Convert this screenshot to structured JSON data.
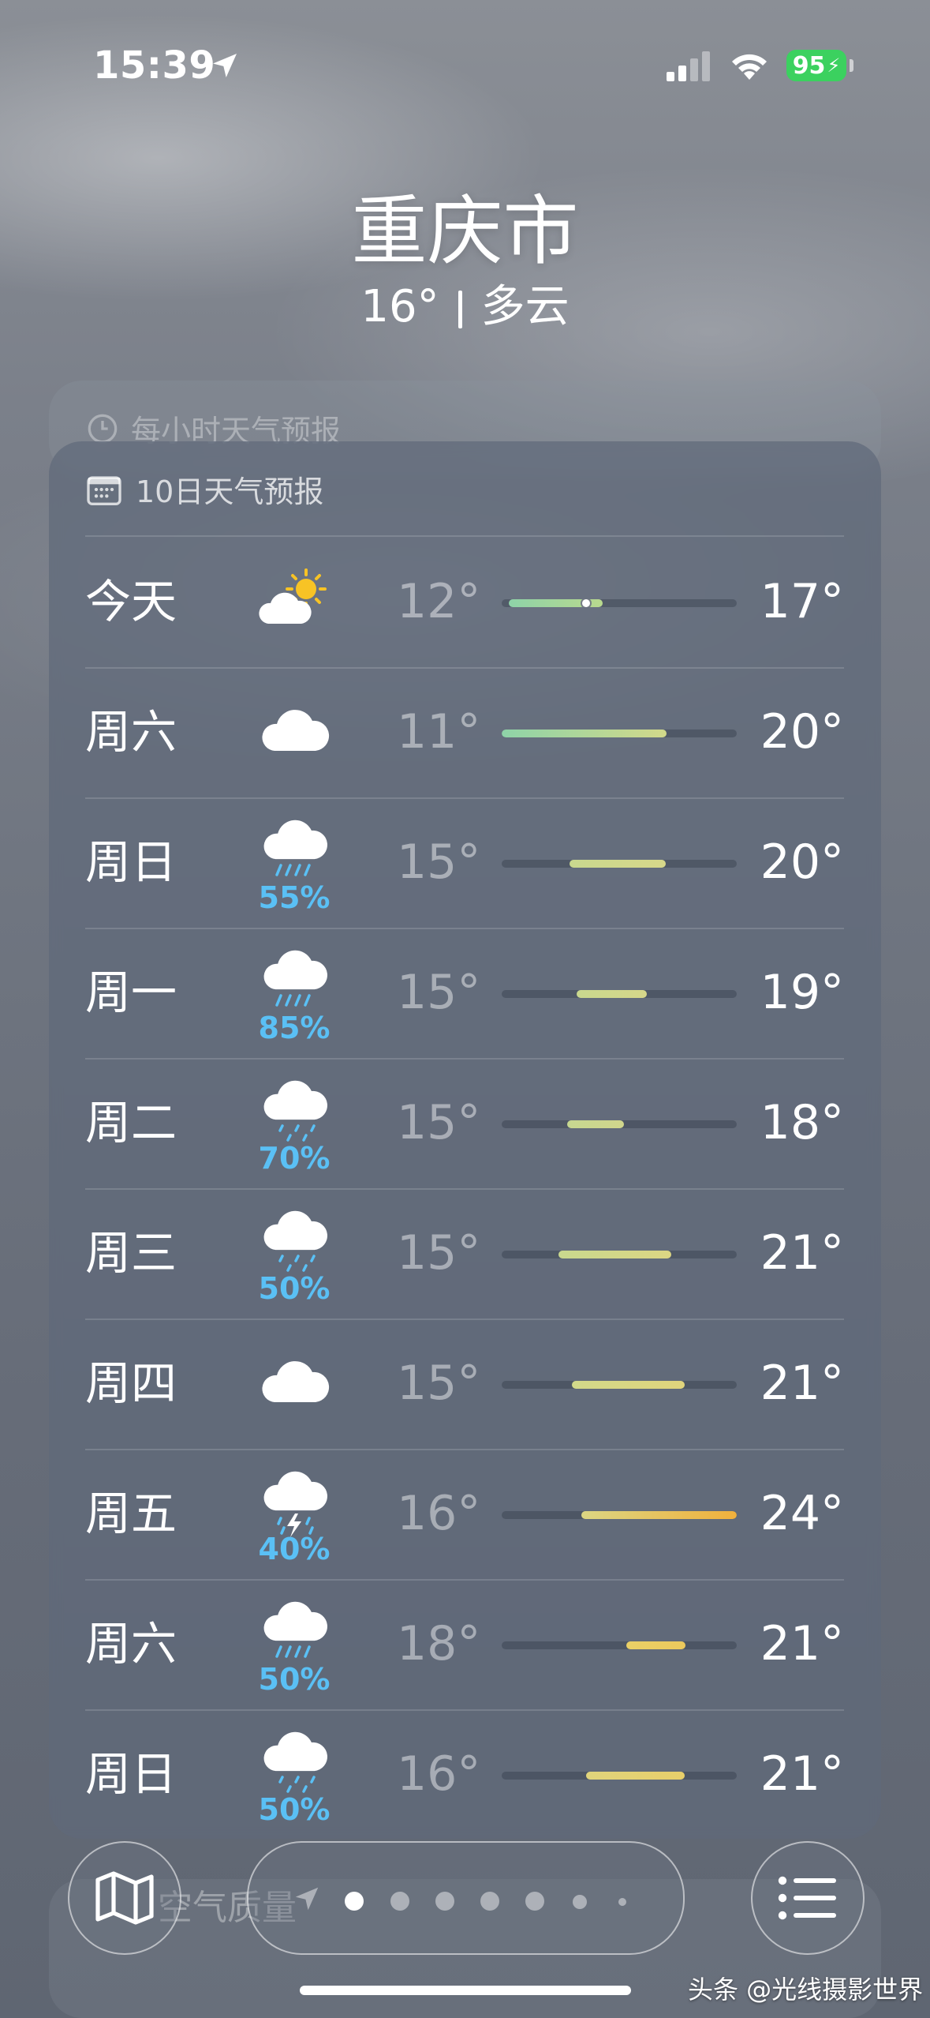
{
  "status_bar": {
    "time": "15:39",
    "battery": "95"
  },
  "location": {
    "city": "重庆市",
    "current_temp": "16°",
    "condition": "多云"
  },
  "hourly_forecast": {
    "title": "每小时天气预报"
  },
  "ten_day": {
    "title": "10日天气预报",
    "days": [
      {
        "day": "今天",
        "icon": "partly-sunny-icon",
        "precip": "",
        "low": "12°",
        "high": "17°",
        "bar_start": 0.03,
        "bar_end": 0.43,
        "colors": [
          "#8ed3a8",
          "#b9d98e"
        ],
        "current": 0.36
      },
      {
        "day": "周六",
        "icon": "cloud-icon",
        "precip": "",
        "low": "11°",
        "high": "20°",
        "bar_start": 0.0,
        "bar_end": 0.7,
        "colors": [
          "#8ed3a8",
          "#d2d98a"
        ]
      },
      {
        "day": "周日",
        "icon": "rain-icon",
        "precip": "55%",
        "low": "15°",
        "high": "20°",
        "bar_start": 0.29,
        "bar_end": 0.7,
        "colors": [
          "#c9d88e",
          "#d7d88a"
        ]
      },
      {
        "day": "周一",
        "icon": "rain-icon",
        "precip": "85%",
        "low": "15°",
        "high": "19°",
        "bar_start": 0.32,
        "bar_end": 0.62,
        "colors": [
          "#c9d88e",
          "#d6d78a"
        ]
      },
      {
        "day": "周二",
        "icon": "drizzle-icon",
        "precip": "70%",
        "low": "15°",
        "high": "18°",
        "bar_start": 0.28,
        "bar_end": 0.52,
        "colors": [
          "#c6d790",
          "#d1d68c"
        ]
      },
      {
        "day": "周三",
        "icon": "drizzle-icon",
        "precip": "50%",
        "low": "15°",
        "high": "21°",
        "bar_start": 0.24,
        "bar_end": 0.72,
        "colors": [
          "#c9d88e",
          "#dcd683"
        ]
      },
      {
        "day": "周四",
        "icon": "cloud-icon",
        "precip": "",
        "low": "15°",
        "high": "21°",
        "bar_start": 0.3,
        "bar_end": 0.78,
        "colors": [
          "#d2d98a",
          "#e0d47c"
        ]
      },
      {
        "day": "周五",
        "icon": "thunderstorm-icon",
        "precip": "40%",
        "low": "16°",
        "high": "24°",
        "bar_start": 0.34,
        "bar_end": 1.0,
        "colors": [
          "#dcd683",
          "#f0b03c"
        ]
      },
      {
        "day": "周六",
        "icon": "rain-icon",
        "precip": "50%",
        "low": "18°",
        "high": "21°",
        "bar_start": 0.53,
        "bar_end": 0.78,
        "colors": [
          "#ead067",
          "#ecc95c"
        ]
      },
      {
        "day": "周日",
        "icon": "drizzle-icon",
        "precip": "50%",
        "low": "16°",
        "high": "21°",
        "bar_start": 0.36,
        "bar_end": 0.78,
        "colors": [
          "#e0d47c",
          "#e8cf6a"
        ]
      }
    ]
  },
  "air_quality": {
    "title": "空气质量"
  },
  "toolbar": {
    "pages": 7,
    "active_page": 1
  },
  "watermark": "头条 @光线摄影世界"
}
